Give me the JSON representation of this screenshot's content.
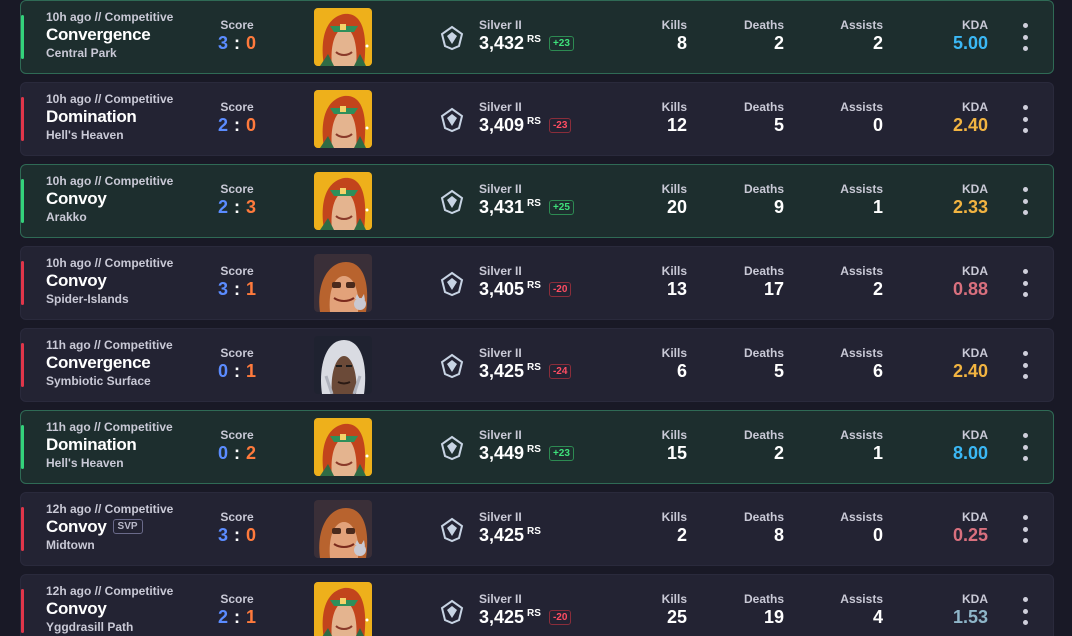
{
  "labels": {
    "score": "Score",
    "kills": "Kills",
    "deaths": "Deaths",
    "assists": "Assists",
    "kda": "KDA",
    "rs_unit": "RS",
    "svp_badge": "SVP"
  },
  "colors": {
    "win_bar": "#34d27b",
    "loss_bar": "#e0364a",
    "score_blue": "#5b8cff",
    "score_orange": "#ff7a3c"
  },
  "matches": [
    {
      "result": "win",
      "time": "10h ago  //  Competitive",
      "mode": "Convergence",
      "map": "Central Park",
      "svp": false,
      "score_blue": "3",
      "score_orange": "0",
      "hero": "redhead-hero-portrait",
      "rank": "Silver II",
      "rs": "3,432",
      "delta": "+23",
      "kills": "8",
      "deaths": "2",
      "assists": "2",
      "kda": "5.00",
      "kda_color": "#3bb8f5"
    },
    {
      "result": "loss",
      "time": "10h ago  //  Competitive",
      "mode": "Domination",
      "map": "Hell's Heaven",
      "svp": false,
      "score_blue": "2",
      "score_orange": "0",
      "hero": "redhead-hero-portrait",
      "rank": "Silver II",
      "rs": "3,409",
      "delta": "-23",
      "kills": "12",
      "deaths": "5",
      "assists": "0",
      "kda": "2.40",
      "kda_color": "#f2b441"
    },
    {
      "result": "win",
      "time": "10h ago  //  Competitive",
      "mode": "Convoy",
      "map": "Arakko",
      "svp": false,
      "score_blue": "2",
      "score_orange": "3",
      "hero": "redhead-hero-portrait",
      "rank": "Silver II",
      "rs": "3,431",
      "delta": "+25",
      "kills": "20",
      "deaths": "9",
      "assists": "1",
      "kda": "2.33",
      "kda_color": "#f2b441"
    },
    {
      "result": "loss",
      "time": "10h ago  //  Competitive",
      "mode": "Convoy",
      "map": "Spider-Islands",
      "svp": false,
      "score_blue": "3",
      "score_orange": "1",
      "hero": "squirrel-hero-portrait",
      "rank": "Silver II",
      "rs": "3,405",
      "delta": "-20",
      "kills": "13",
      "deaths": "17",
      "assists": "2",
      "kda": "0.88",
      "kda_color": "#d9707e"
    },
    {
      "result": "loss",
      "time": "11h ago  //  Competitive",
      "mode": "Convergence",
      "map": "Symbiotic Surface",
      "svp": false,
      "score_blue": "0",
      "score_orange": "1",
      "hero": "white-hair-hero-portrait",
      "rank": "Silver II",
      "rs": "3,425",
      "delta": "-24",
      "kills": "6",
      "deaths": "5",
      "assists": "6",
      "kda": "2.40",
      "kda_color": "#f2b441"
    },
    {
      "result": "win",
      "time": "11h ago  //  Competitive",
      "mode": "Domination",
      "map": "Hell's Heaven",
      "svp": false,
      "score_blue": "0",
      "score_orange": "2",
      "hero": "redhead-hero-portrait",
      "rank": "Silver II",
      "rs": "3,449",
      "delta": "+23",
      "kills": "15",
      "deaths": "2",
      "assists": "1",
      "kda": "8.00",
      "kda_color": "#3bb8f5"
    },
    {
      "result": "loss",
      "time": "12h ago  //  Competitive",
      "mode": "Convoy",
      "map": "Midtown",
      "svp": true,
      "score_blue": "3",
      "score_orange": "0",
      "hero": "squirrel-hero-portrait",
      "rank": "Silver II",
      "rs": "3,425",
      "delta": "",
      "kills": "2",
      "deaths": "8",
      "assists": "0",
      "kda": "0.25",
      "kda_color": "#d9707e"
    },
    {
      "result": "loss",
      "time": "12h ago  //  Competitive",
      "mode": "Convoy",
      "map": "Yggdrasill Path",
      "svp": false,
      "score_blue": "2",
      "score_orange": "1",
      "hero": "redhead-hero-portrait",
      "rank": "Silver II",
      "rs": "3,425",
      "delta": "-20",
      "kills": "25",
      "deaths": "19",
      "assists": "4",
      "kda": "1.53",
      "kda_color": "#8fb6c9"
    }
  ]
}
